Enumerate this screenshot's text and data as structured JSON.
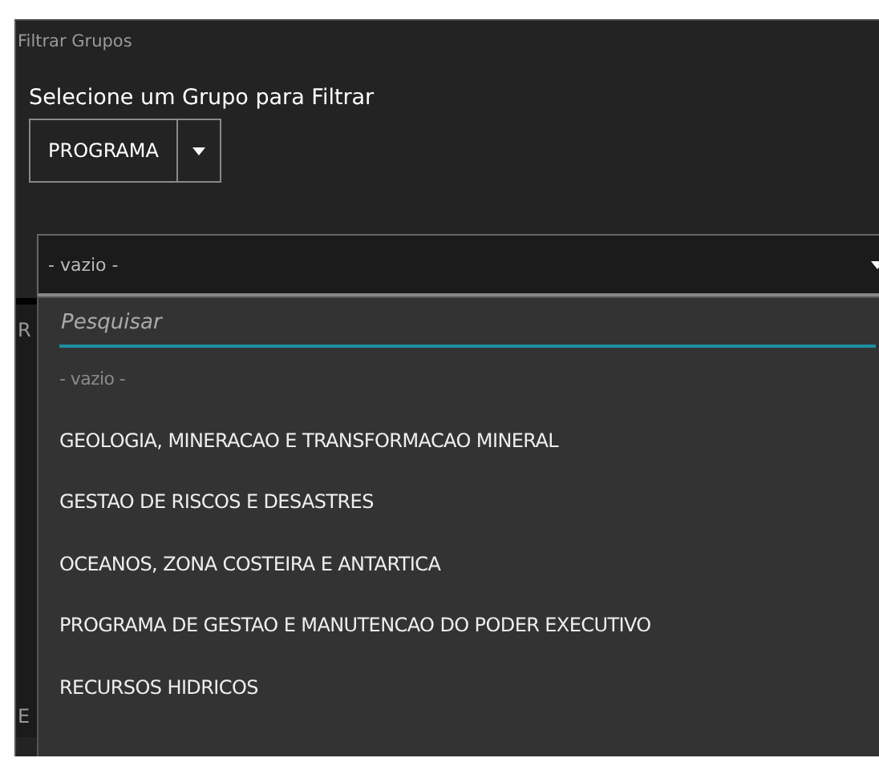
{
  "panel": {
    "title": "Filtrar Grupos",
    "prompt": "Selecione um Grupo para Filtrar"
  },
  "group_select": {
    "value": "PROGRAMA"
  },
  "value_select": {
    "value": "- vazio -",
    "expanded": true
  },
  "behind_labels": [
    "R",
    "E"
  ],
  "dropdown": {
    "search": {
      "placeholder": "Pesquisar"
    },
    "options": [
      {
        "label": "- vazio -",
        "kind": "empty"
      },
      {
        "label": "GEOLOGIA, MINERACAO E TRANSFORMACAO MINERAL",
        "kind": "option"
      },
      {
        "label": "GESTAO DE RISCOS E DESASTRES",
        "kind": "option"
      },
      {
        "label": "OCEANOS, ZONA COSTEIRA E ANTARTICA",
        "kind": "option"
      },
      {
        "label": "PROGRAMA DE GESTAO E MANUTENCAO DO PODER EXECUTIVO",
        "kind": "option"
      },
      {
        "label": "RECURSOS HIDRICOS",
        "kind": "option"
      }
    ]
  }
}
